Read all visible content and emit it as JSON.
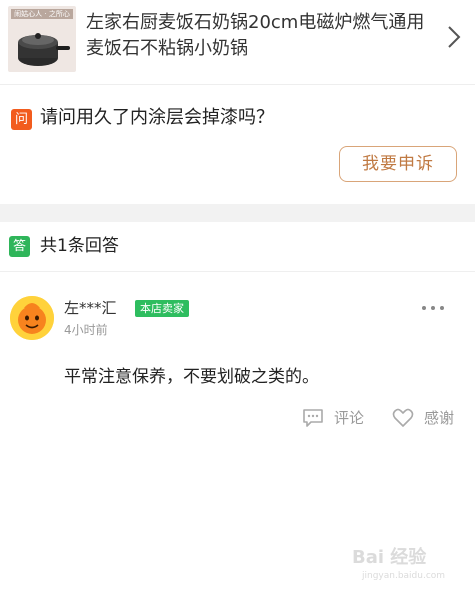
{
  "product": {
    "thumb_banner": "闹姑心人 · 之所心",
    "title": "左家右厨麦饭石奶锅20cm电磁炉燃气通用麦饭石不粘锅小奶锅"
  },
  "question": {
    "badge": "问",
    "text": "请问用久了内涂层会掉漆吗？",
    "complain_label": "我要申诉"
  },
  "answers": {
    "badge": "答",
    "count_text": "共1条回答"
  },
  "answer": {
    "user_name": "左***汇",
    "seller_tag": "本店卖家",
    "time": "4小时前",
    "text": "平常注意保养，不要划破之类的。",
    "comment_label": "评论",
    "thanks_label": "感谢"
  },
  "watermark": {
    "text": "Bai 经验",
    "sub": "jingyan.baidu.com"
  },
  "colors": {
    "question_badge": "#f25c1e",
    "answer_badge": "#2fb55a",
    "complain_border": "#d9a579",
    "seller_tag": "#2ebd5f"
  }
}
